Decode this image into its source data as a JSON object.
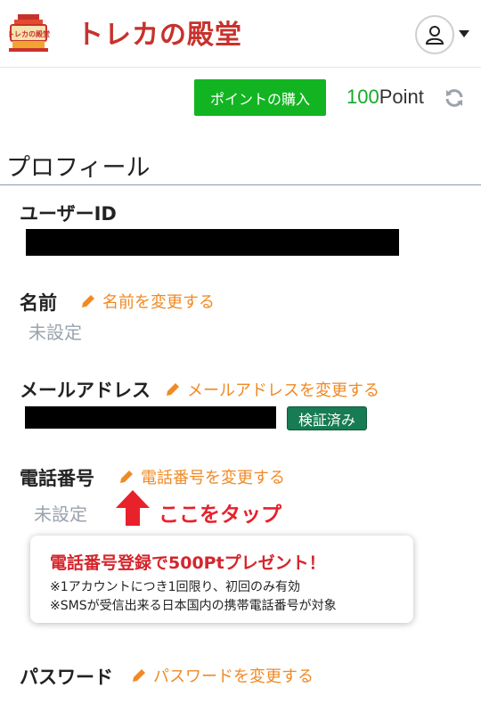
{
  "header": {
    "logo_badge_text": "トレカの殿堂",
    "logo_text": "トレカの殿堂"
  },
  "points": {
    "buy_label": "ポイントの購入",
    "amount": "100",
    "unit": "Point"
  },
  "profile": {
    "title": "プロフィール",
    "user_id_label": "ユーザーID",
    "name_label": "名前",
    "name_edit": "名前を変更する",
    "name_value": "未設定",
    "email_label": "メールアドレス",
    "email_edit": "メールアドレスを変更する",
    "email_verified": "検証済み",
    "phone_label": "電話番号",
    "phone_edit": "電話番号を変更する",
    "phone_value": "未設定",
    "tap_here": "ここをタップ",
    "password_label": "パスワード",
    "password_edit": "パスワードを変更する"
  },
  "promo": {
    "title": "電話番号登録で500Ptプレゼント！",
    "note1": "※1アカウントにつき1回限り、初回のみ有効",
    "note2": "※SMSが受信出来る日本国内の携帯電話番号が対象"
  },
  "colors": {
    "brand_red": "#c7322c",
    "buy_green": "#12b521",
    "point_green": "#16a92a",
    "edit_orange": "#f08a25",
    "verified_green": "#177b53",
    "alert_red": "#e8212b"
  }
}
